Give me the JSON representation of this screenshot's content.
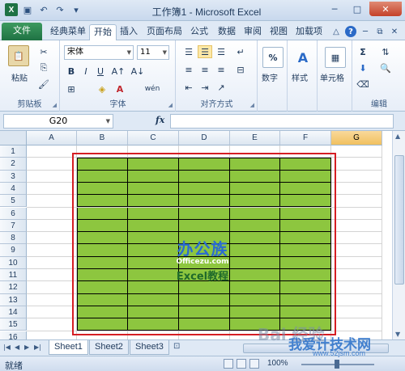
{
  "window": {
    "title": "工作簿1 - Microsoft Excel",
    "app_icon": "X",
    "minimize": "─",
    "maximize": "□",
    "close": "✕"
  },
  "tabs": [
    {
      "label": "文件"
    },
    {
      "label": "经典菜单"
    },
    {
      "label": "开始"
    },
    {
      "label": "插入"
    },
    {
      "label": "页面布局"
    },
    {
      "label": "公式"
    },
    {
      "label": "数据"
    },
    {
      "label": "审阅"
    },
    {
      "label": "视图"
    },
    {
      "label": "加载项"
    }
  ],
  "ribbon": {
    "clipboard": {
      "label": "剪贴板",
      "paste": "粘贴"
    },
    "font": {
      "label": "字体",
      "font_name": "宋体",
      "font_size": "11",
      "bold": "B",
      "italic": "I",
      "underline": "U",
      "text_color_glyph": "A",
      "wen": "wén"
    },
    "alignment": {
      "label": "对齐方式"
    },
    "number": {
      "label": "数字",
      "glyph": "%"
    },
    "styles": {
      "label": "样式",
      "glyph": "A"
    },
    "cells": {
      "label": "单元格"
    },
    "editing": {
      "label": "编辑",
      "sum_glyph": "Σ"
    }
  },
  "formula_bar": {
    "name_box": "G20",
    "fx": "fx",
    "value": ""
  },
  "columns": [
    "A",
    "B",
    "C",
    "D",
    "E",
    "F",
    "G"
  ],
  "active_column": "G",
  "rows": [
    "1",
    "2",
    "3",
    "4",
    "5",
    "6",
    "7",
    "8",
    "9",
    "10",
    "11",
    "12",
    "13",
    "14",
    "15",
    "16"
  ],
  "table_fill_color": "#8dc63f",
  "selection_border_color": "#d51e24",
  "watermark": {
    "logo": "办公族",
    "site": "Officezu.com",
    "tutorial": "Excel教程"
  },
  "sheets": [
    "Sheet1",
    "Sheet2",
    "Sheet3"
  ],
  "active_sheet": "Sheet1",
  "status": {
    "ready": "就绪",
    "zoom": "100%"
  },
  "footer_watermark": {
    "baidu": "Bai 经验",
    "site_cn": "我爱计技术网",
    "site_url": "www.52jsm.com"
  }
}
